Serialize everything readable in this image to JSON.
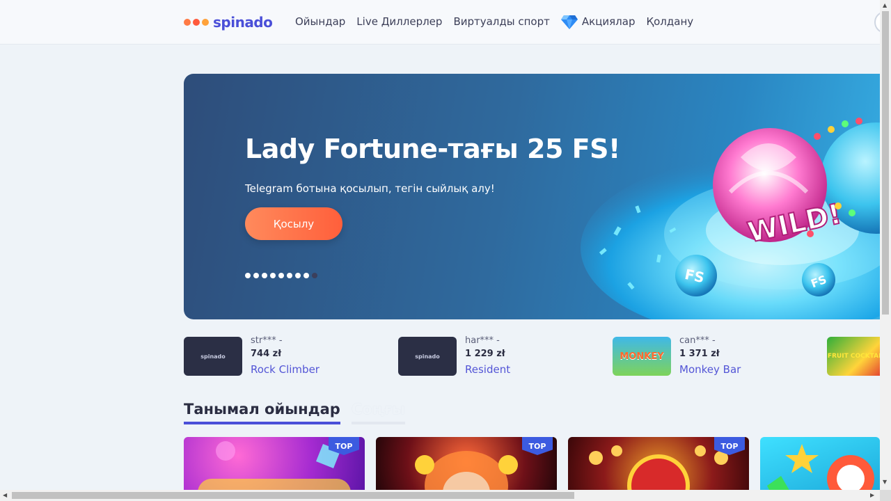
{
  "header": {
    "logo_text": "spinado",
    "nav": [
      {
        "label": "Ойындар"
      },
      {
        "label": "Live Диллерлер"
      },
      {
        "label": "Виртуалды спорт"
      },
      {
        "label": "Акциялар",
        "icon": "diamond-icon"
      },
      {
        "label": "Қолдану"
      }
    ]
  },
  "banner": {
    "title": "Lady Fortune-тағы 25 FS!",
    "subtitle": "Telegram ботына қосылып, тегін сыйлық алу!",
    "button_label": "Қосылу",
    "slides_total": 9,
    "active_slide": 9,
    "art_text_wild": "WILD!",
    "art_text_fs": "FS"
  },
  "winners": [
    {
      "user": "str*** -",
      "amount": "744 zł",
      "game": "Rock Climber",
      "thumb_text": "spinado"
    },
    {
      "user": "har*** -",
      "amount": "1 229 zł",
      "game": "Resident",
      "thumb_text": "spinado"
    },
    {
      "user": "can*** -",
      "amount": "1 371 zł",
      "game": "Monkey Bar",
      "thumb_text": "MONKEY"
    },
    {
      "user": "",
      "amount": "",
      "game": "",
      "thumb_text": "FRUIT COCKTAIL"
    }
  ],
  "tabs": [
    {
      "label": "Танымал ойындар",
      "active": true
    },
    {
      "label": "Соңғы",
      "active": false
    }
  ],
  "games": [
    {
      "badge": "TOP",
      "theme": "#c43bc9"
    },
    {
      "badge": "TOP",
      "theme": "#8a1b22"
    },
    {
      "badge": "TOP",
      "theme": "#6b0f18"
    },
    {
      "badge": "",
      "theme": "#2bc6e6"
    }
  ],
  "colors": {
    "accent": "#4a4fd8",
    "button_gradient_start": "#ff8a5c",
    "button_gradient_end": "#ff5f3b"
  }
}
